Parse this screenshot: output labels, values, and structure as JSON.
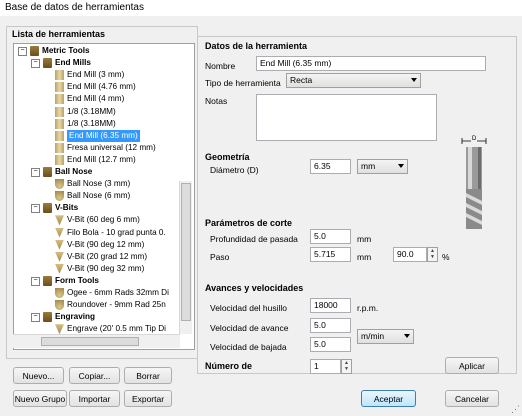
{
  "window": {
    "title": "Base de datos de herramientas"
  },
  "tree_panel": {
    "title": "Lista de herramientas",
    "rows": [
      {
        "label": "Metric Tools",
        "level": 0,
        "type": "folder",
        "bold": true,
        "expanded": true
      },
      {
        "label": "End Mills",
        "level": 1,
        "type": "folder",
        "bold": true,
        "expanded": true
      },
      {
        "label": "End Mill (3 mm)",
        "level": 2,
        "type": "mill"
      },
      {
        "label": "End Mill (4.76 mm)",
        "level": 2,
        "type": "mill"
      },
      {
        "label": "End Mill (4 mm)",
        "level": 2,
        "type": "mill"
      },
      {
        "label": "1/8 (3.18MM)",
        "level": 2,
        "type": "mill"
      },
      {
        "label": "1/8 (3.18MM)",
        "level": 2,
        "type": "mill"
      },
      {
        "label": "End Mill (6.35 mm)",
        "level": 2,
        "type": "mill",
        "selected": true
      },
      {
        "label": "Fresa universal (12 mm)",
        "level": 2,
        "type": "mill"
      },
      {
        "label": "End Mill (12.7 mm)",
        "level": 2,
        "type": "mill"
      },
      {
        "label": "Ball Nose",
        "level": 1,
        "type": "folder",
        "bold": true,
        "expanded": true
      },
      {
        "label": "Ball Nose (3 mm)",
        "level": 2,
        "type": "ball"
      },
      {
        "label": "Ball Nose (6 mm)",
        "level": 2,
        "type": "ball"
      },
      {
        "label": "V-Bits",
        "level": 1,
        "type": "folder",
        "bold": true,
        "expanded": true
      },
      {
        "label": "V-Bit (60 deg 6 mm)",
        "level": 2,
        "type": "vbit"
      },
      {
        "label": "Filo Bola - 10 grad punta 0.",
        "level": 2,
        "type": "vbit"
      },
      {
        "label": "V-Bit (90 deg 12 mm)",
        "level": 2,
        "type": "vbit"
      },
      {
        "label": "V-Bit (20 grad 12 mm)",
        "level": 2,
        "type": "vbit"
      },
      {
        "label": "V-Bit (90 deg 32 mm)",
        "level": 2,
        "type": "vbit"
      },
      {
        "label": "Form Tools",
        "level": 1,
        "type": "folder",
        "bold": true,
        "expanded": true
      },
      {
        "label": "Ogee - 6mm Rads 32mm Di",
        "level": 2,
        "type": "ball"
      },
      {
        "label": "Roundover - 9mm Rad 25n",
        "level": 2,
        "type": "ball"
      },
      {
        "label": "Engraving",
        "level": 1,
        "type": "folder",
        "bold": true,
        "expanded": true
      },
      {
        "label": "Engrave (20' 0.5 mm Tip Di",
        "level": 2,
        "type": "vbit"
      }
    ]
  },
  "tree_buttons": {
    "new": "Nuevo...",
    "copy": "Copiar...",
    "delete": "Borrar",
    "new_group": "Nuevo Grupo",
    "import": "Importar",
    "export": "Exportar"
  },
  "tool_data": {
    "section_title": "Datos de la herramienta",
    "name_label": "Nombre",
    "name_value": "End Mill (6.35 mm)",
    "type_label": "Tipo de herramienta",
    "type_value": "Recta",
    "notes_label": "Notas",
    "notes_value": ""
  },
  "geometry": {
    "title": "Geometría",
    "diameter_label": "Diámetro (D)",
    "diameter_value": "6.35",
    "unit_value": "mm",
    "diagram_label": "D"
  },
  "cutting": {
    "title": "Parámetros de corte",
    "pass_depth_label": "Profundidad de pasada",
    "pass_depth_value": "5.0",
    "pass_depth_unit": "mm",
    "stepover_label": "Paso",
    "stepover_value": "5.715",
    "stepover_unit": "mm",
    "stepover_percent": "90.0",
    "percent_sign": "%"
  },
  "feeds": {
    "title": "Avances y velocidades",
    "spindle_label": "Velocidad del husillo",
    "spindle_value": "18000",
    "spindle_unit": "r.p.m.",
    "feed_label": "Velocidad de avance",
    "feed_value": "5.0",
    "plunge_label": "Velocidad de bajada",
    "plunge_value": "5.0",
    "rate_unit": "m/min"
  },
  "tool_number": {
    "label": "Número de",
    "value": "1"
  },
  "actions": {
    "apply": "Aplicar",
    "ok": "Aceptar",
    "cancel": "Cancelar"
  }
}
